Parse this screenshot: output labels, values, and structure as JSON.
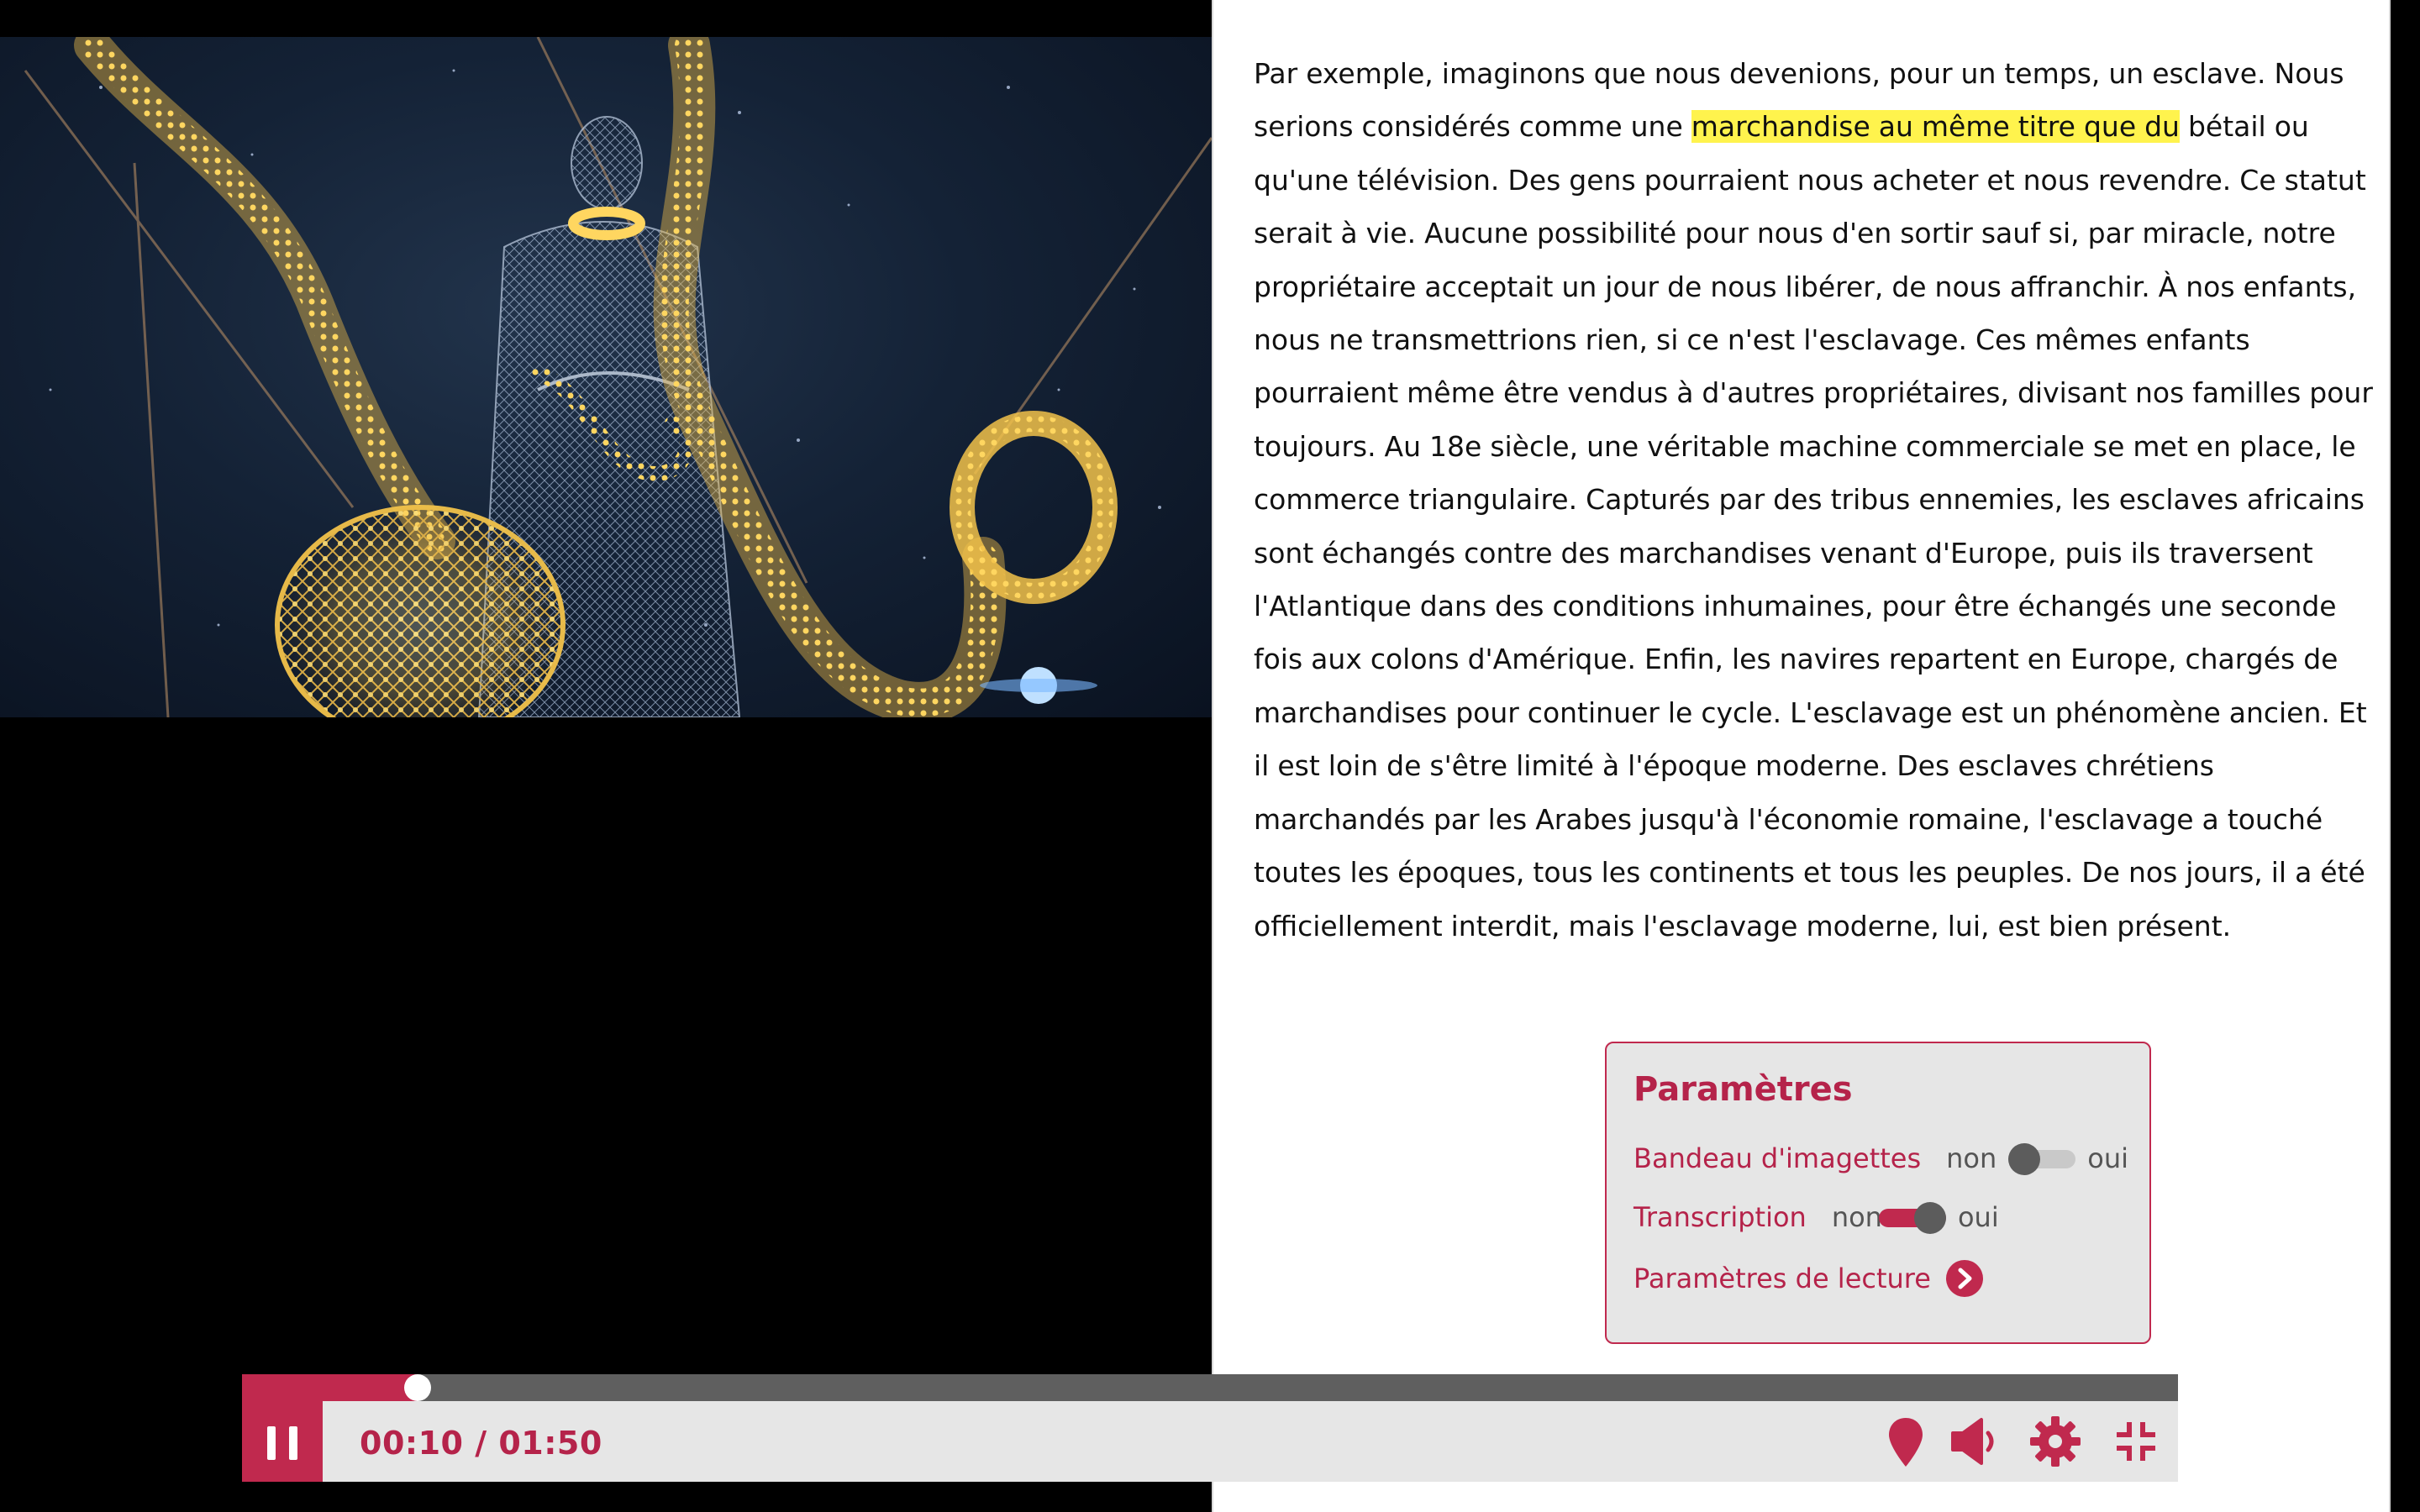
{
  "transcript": {
    "before": "Par exemple, imaginons que nous devenions, pour un temps, un esclave. Nous serions considérés comme une ",
    "highlight": "marchandise au même titre que du",
    "after": " bétail ou qu'une télévision. Des gens pourraient nous acheter et nous revendre. Ce statut serait à vie. Aucune possibilité pour nous d'en sortir sauf si, par miracle, notre propriétaire acceptait un jour de nous libérer, de nous affranchir. À nos enfants, nous ne transmettrions rien, si ce n'est l'esclavage. Ces mêmes enfants pourraient même être vendus à d'autres propriétaires, divisant nos familles pour toujours. Au 18e siècle, une véritable machine commerciale se met en place, le commerce triangulaire. Capturés par des tribus ennemies, les esclaves africains sont échangés contre des marchandises venant d'Europe, puis ils traversent l'Atlantique dans des conditions inhumaines, pour être échangés une seconde fois aux colons d'Amérique. Enfin, les navires repartent en Europe, chargés de marchandises pour continuer le cycle. L'esclavage est un phénomène ancien. Et il est loin de s'être limité à l'époque moderne. Des esclaves chrétiens marchandés par les Arabes jusqu'à l'économie romaine, l'esclavage a touché toutes les époques, tous les continents et tous les peuples. De nos jours, il a été officiellement interdit, mais l'esclavage moderne, lui, est bien présent."
  },
  "settings": {
    "title": "Paramètres",
    "thumbnail_strip": {
      "label": "Bandeau d'imagettes",
      "off": "non",
      "on": "oui",
      "enabled": false
    },
    "transcription": {
      "label": "Transcription",
      "off": "non",
      "on": "oui",
      "enabled": true
    },
    "reading_settings": "Paramètres de lecture"
  },
  "player": {
    "current_time": "00:10",
    "separator": "/",
    "duration": "01:50",
    "progress": 0.0909,
    "buttons": [
      "pause-icon",
      "chapter-marker-icon",
      "volume-icon",
      "gear-icon",
      "exit-fullscreen-icon"
    ]
  },
  "colors": {
    "accent": "#c0294e",
    "highlight": "#fff34d",
    "controls_bg": "#e6e6e6"
  }
}
